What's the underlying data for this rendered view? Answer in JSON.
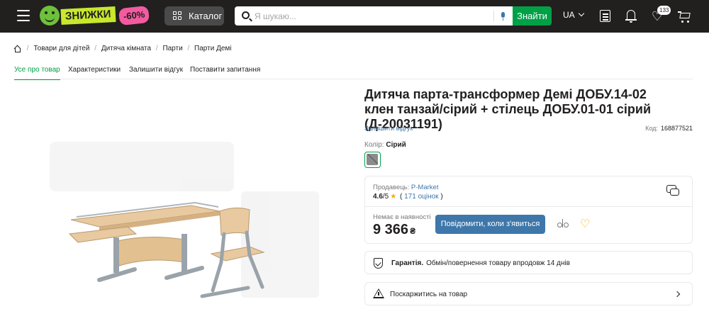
{
  "header": {
    "logo_text": "ЗНИЖКИ",
    "logo_badge": "-60%",
    "catalog_label": "Каталог",
    "search_placeholder": "Я шукаю...",
    "search_button": "Знайти",
    "language": "UA",
    "wishlist_count": "133",
    "icons": [
      "menu-icon",
      "grid-icon",
      "search-icon",
      "mic-icon",
      "chevron-down-icon",
      "list-icon",
      "bell-icon",
      "heart-icon",
      "cart-icon"
    ]
  },
  "breadcrumb": {
    "items": [
      "Товари для дітей",
      "Дитяча кімната",
      "Парти",
      "Парти Демі"
    ]
  },
  "tabs": [
    "Усе про товар",
    "Характеристики",
    "Залишити відгук",
    "Поставити запитання"
  ],
  "product": {
    "title": "Дитяча парта-трансформер Демі ДОБУ.14-02 клен танзай/сірий + стілець ДОБУ.01-01 сірий (Д-20031191)",
    "review_link": "Залишити відгук",
    "code_label": "Код:",
    "code_value": "168877521",
    "color_label": "Колір:",
    "color_value": "Сірий",
    "seller_label": "Продавець:",
    "seller_name": "P-Market",
    "rating_value": "4.6",
    "rating_suffix": "/5",
    "rating_count": "171 оцінок",
    "stock_status": "Немає в наявності",
    "price": "9 366",
    "currency": "₴",
    "notify_button": "Повідомити, коли з'явиться",
    "guarantee_label": "Гарантія.",
    "guarantee_text": "Обмін/повернення товару впродовж 14 днів",
    "complain_text": "Поскаржитись на товар"
  },
  "colors": {
    "header_bg": "#221f1f",
    "green": "#00a046",
    "blue": "#3e77aa",
    "star": "#ffa900"
  }
}
